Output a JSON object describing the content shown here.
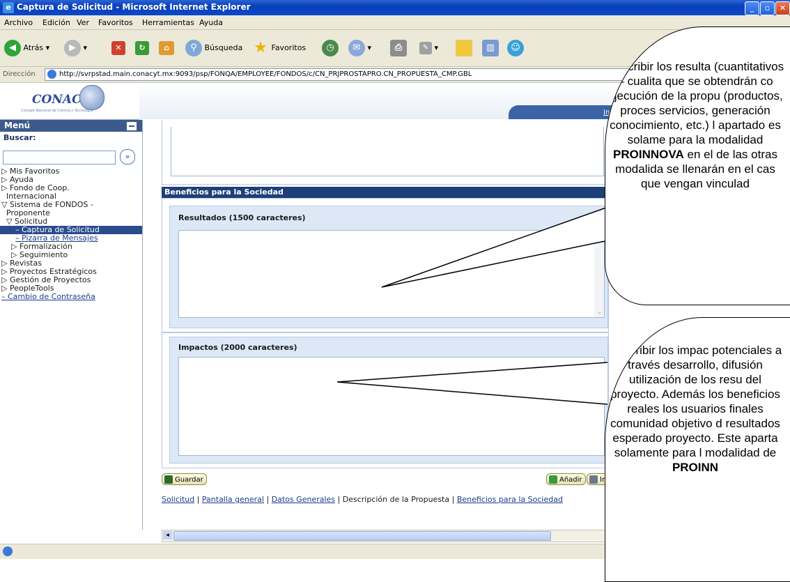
{
  "window": {
    "title": "Captura de Solicitud - Microsoft Internet Explorer",
    "controls": [
      "minimize",
      "maximize",
      "close"
    ]
  },
  "menubar": [
    "Archivo",
    "Edición",
    "Ver",
    "Favoritos",
    "Herramientas",
    "Ayuda"
  ],
  "toolbar": {
    "back_label": "Atrás",
    "search_label": "Búsqueda",
    "favorites_label": "Favoritos"
  },
  "address": {
    "label": "Dirección",
    "url": "http://svrpstad.main.conacyt.mx:9093/psp/FONQA/EMPLOYEE/FONDOS/c/CN_PRJPROSTAPRO.CN_PROPUESTA_CMP.GBL"
  },
  "header": {
    "logo_text": "CONACYT",
    "logo_subtitle": "Consejo Nacional de Ciencia y Tecnología",
    "home_link": "Inicio"
  },
  "nav": {
    "title": "Menú",
    "search_label": "Buscar:",
    "go_symbol": "»",
    "items": [
      "▷ Mis Favoritos",
      "▷ Ayuda",
      "▷ Fondo de Coop.",
      "Internacional",
      "▽ Sistema de FONDOS -",
      "Proponente",
      "▽ Solicitud",
      "– Captura de Solicitud",
      "– Pizarra de Mensajes",
      "▷ Formalización",
      "▷ Seguimiento",
      "▷ Revistas",
      "▷ Proyectos Estratégicos",
      "▷ Gestión de Proyectos",
      "▷ PeopleTools",
      "– Cambio de Contraseña"
    ]
  },
  "main": {
    "section_title": "Beneficios para la Sociedad",
    "resultados_label": "Resultados (1500 caracteres)",
    "impactos_label": "Impactos (2000 caracteres)",
    "save_button": "Guardar",
    "add_button": "Añadir",
    "include_button": "Incluir",
    "links": [
      "Solicitud",
      "Pantalla general",
      "Datos Generales",
      "Descripción de la Propuesta",
      "Beneficios para la Sociedad"
    ]
  },
  "callouts": {
    "resultados_text_1": "Describir los resulta (cuantitativos – cualita que se obtendrán co ejecución de la propu (productos, proces servicios, generación conocimiento, etc.) l apartado es solame para la modalidad",
    "resultados_bold": "PROINNOVA",
    "resultados_text_2": "en el de las otras modalida se llenarán en el cas que vengan vinculad",
    "impactos_text_1": "Describir los impac potenciales a través desarrollo, difusión utilización de los resu del proyecto. Además los beneficios reales los usuarios finales comunidad objetivo d resultados esperado proyecto. Este aparta solamente para l modalidad de",
    "impactos_bold": "PROINN"
  }
}
